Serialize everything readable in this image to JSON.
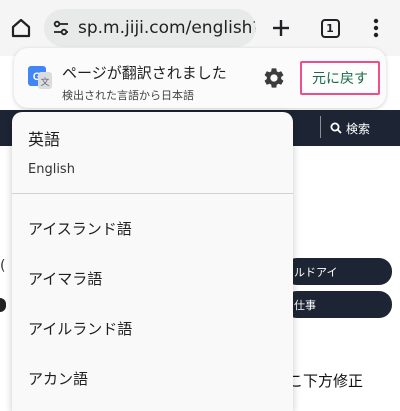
{
  "browser": {
    "url": "sp.m.jiji.com/english?page",
    "tab_count": "1"
  },
  "background_page": {
    "search_label": "検索",
    "pill_1": "ルドアイ",
    "pill_2": "仕事",
    "text_fragment": "こ下方修正"
  },
  "translate_bar": {
    "title": "ページが翻訳されました",
    "subtitle": "検出された言語から日本語",
    "revert_label": "元に戻す",
    "accent_color": "#f04d8a",
    "revert_text_color": "#1a6a46"
  },
  "language_menu": {
    "current_native": "英語",
    "current_english": "English",
    "items": [
      "アイスランド語",
      "アイマラ語",
      "アイルランド語",
      "アカン語"
    ]
  }
}
